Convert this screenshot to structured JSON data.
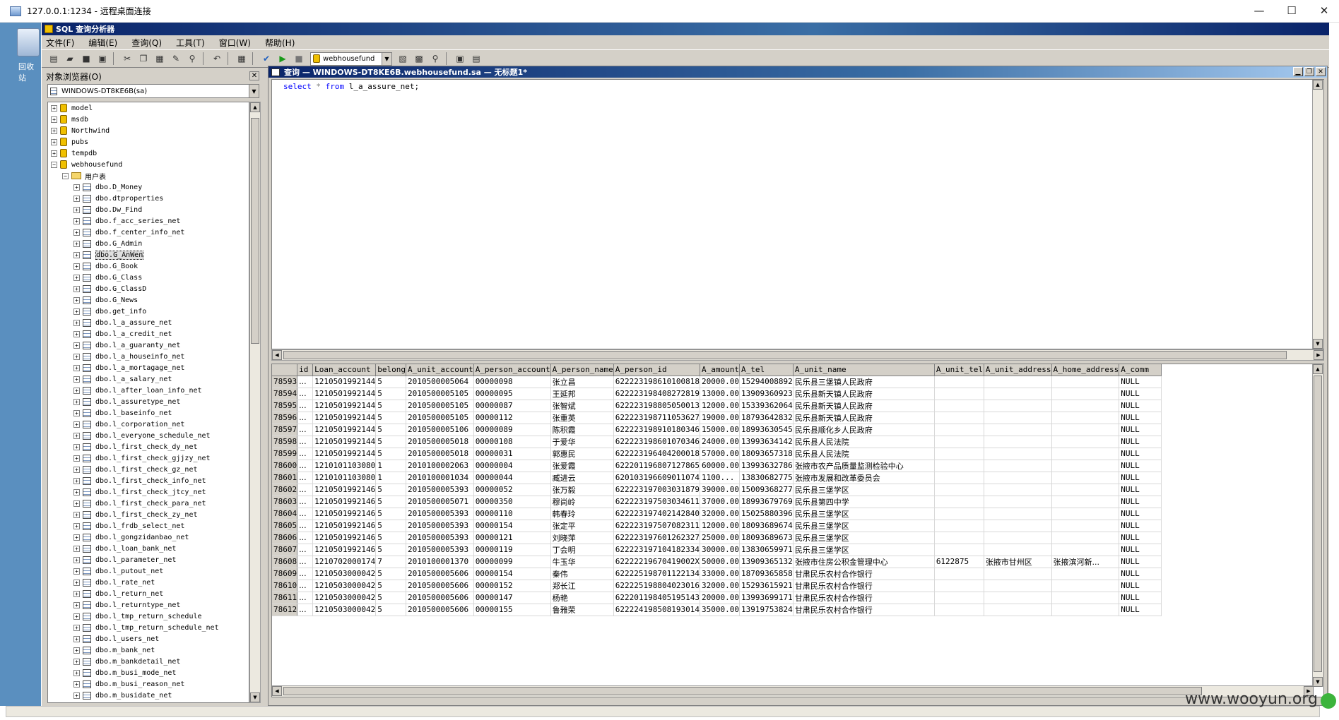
{
  "rdp": {
    "title": "127.0.0.1:1234 - 远程桌面连接",
    "minimize": "—",
    "maximize": "☐",
    "close": "✕",
    "recycle_label": "回收站"
  },
  "app": {
    "title": "SQL 查询分析器"
  },
  "menu": [
    "文件(F)",
    "编辑(E)",
    "查询(Q)",
    "工具(T)",
    "窗口(W)",
    "帮助(H)"
  ],
  "toolbar": {
    "database": "webhousefund"
  },
  "object_browser": {
    "title": "对象浏览器(O)",
    "server": "WINDOWS-DT8KE6B(sa)",
    "databases": [
      "model",
      "msdb",
      "Northwind",
      "pubs",
      "tempdb",
      "webhousefund"
    ],
    "folder": "用户表",
    "tables": [
      "dbo.D_Money",
      "dbo.dtproperties",
      "dbo.Dw_Find",
      "dbo.f_acc_series_net",
      "dbo.f_center_info_net",
      "dbo.G_Admin",
      "dbo.G_AnWen",
      "dbo.G_Book",
      "dbo.G_Class",
      "dbo.G_ClassD",
      "dbo.G_News",
      "dbo.get_info",
      "dbo.l_a_assure_net",
      "dbo.l_a_credit_net",
      "dbo.l_a_guaranty_net",
      "dbo.l_a_houseinfo_net",
      "dbo.l_a_mortagage_net",
      "dbo.l_a_salary_net",
      "dbo.l_after_loan_info_net",
      "dbo.l_assuretype_net",
      "dbo.l_baseinfo_net",
      "dbo.l_corporation_net",
      "dbo.l_everyone_schedule_net",
      "dbo.l_first_check_dy_net",
      "dbo.l_first_check_gjjzy_net",
      "dbo.l_first_check_gz_net",
      "dbo.l_first_check_info_net",
      "dbo.l_first_check_jtcy_net",
      "dbo.l_first_check_para_net",
      "dbo.l_first_check_zy_net",
      "dbo.l_frdb_select_net",
      "dbo.l_gongzidanbao_net",
      "dbo.l_loan_bank_net",
      "dbo.l_parameter_net",
      "dbo.l_putout_net",
      "dbo.l_rate_net",
      "dbo.l_return_net",
      "dbo.l_returntype_net",
      "dbo.l_tmp_return_schedule",
      "dbo.l_tmp_return_schedule_net",
      "dbo.l_users_net",
      "dbo.m_bank_net",
      "dbo.m_bankdetail_net",
      "dbo.m_busi_mode_net",
      "dbo.m_busi_reason_net",
      "dbo.m_busidate_net"
    ],
    "selected_table": "dbo.G_AnWen"
  },
  "query": {
    "title": "查询 — WINDOWS-DT8KE6B.webhousefund.sa — 无标题1*",
    "kw_select": "select",
    "star": "*",
    "kw_from": "from",
    "rest": "l_a_assure_net;"
  },
  "results": {
    "columns": [
      "id",
      "Loan_account",
      "belong",
      "A_unit_account",
      "A_person_account",
      "A_person_name",
      "A_person_id",
      "A_amount",
      "A_tel",
      "A_unit_name",
      "A_unit_tel",
      "A_unit_address",
      "A_home_address",
      "A_comm"
    ],
    "rows": [
      [
        "78593",
        "...",
        "1210501992144",
        "5",
        "2010500005064",
        "00000098",
        "张立昌",
        "622223198610100818",
        "20000.00",
        "15294008892",
        "民乐县三堡镇人民政府",
        "",
        "",
        "",
        "NULL"
      ],
      [
        "78594",
        "...",
        "1210501992144",
        "5",
        "2010500005105",
        "00000095",
        "王延邦",
        "622223198408272819",
        "13000.00",
        "13909360923",
        "民乐县新天镇人民政府",
        "",
        "",
        "",
        "NULL"
      ],
      [
        "78595",
        "...",
        "1210501992144",
        "5",
        "2010500005105",
        "00000087",
        "张智斌",
        "622223198805050013",
        "12000.00",
        "15339362064",
        "民乐县新天镇人民政府",
        "",
        "",
        "",
        "NULL"
      ],
      [
        "78596",
        "...",
        "1210501992144",
        "5",
        "2010500005105",
        "00000112",
        "张重英",
        "622223198711053627",
        "19000.00",
        "18793642832",
        "民乐县新天镇人民政府",
        "",
        "",
        "",
        "NULL"
      ],
      [
        "78597",
        "...",
        "1210501992144",
        "5",
        "2010500005106",
        "00000089",
        "陈积霞",
        "622223198910180346",
        "15000.00",
        "18993630545",
        "民乐县顺化乡人民政府",
        "",
        "",
        "",
        "NULL"
      ],
      [
        "78598",
        "...",
        "1210501992144",
        "5",
        "2010500005018",
        "00000108",
        "于爱华",
        "622223198601070346",
        "24000.00",
        "13993634142",
        "民乐县人民法院",
        "",
        "",
        "",
        "NULL"
      ],
      [
        "78599",
        "...",
        "1210501992144",
        "5",
        "2010500005018",
        "00000031",
        "郭惠民",
        "622223196404200018",
        "57000.00",
        "18093657318",
        "民乐县人民法院",
        "",
        "",
        "",
        "NULL"
      ],
      [
        "78600",
        "...",
        "1210101103080",
        "1",
        "2010100002063",
        "00000004",
        "张爱霞",
        "622201196807127865",
        "60000.00",
        "13993632786",
        "张掖市农产品质量监测检验中心",
        "",
        "",
        "",
        "NULL"
      ],
      [
        "78601",
        "...",
        "1210101103080",
        "1",
        "2010100001034",
        "00000044",
        "臧进云",
        "620103196609011074",
        "1100...",
        "13830682775",
        "张掖市发展和改革委员会",
        "",
        "",
        "",
        "NULL"
      ],
      [
        "78602",
        "...",
        "1210501992146",
        "5",
        "2010500005393",
        "00000052",
        "张万毅",
        "622223197003031879",
        "39000.00",
        "15009368277",
        "民乐县三堡学区",
        "",
        "",
        "",
        "NULL"
      ],
      [
        "78603",
        "...",
        "1210501992146",
        "5",
        "2010500005071",
        "00000350",
        "穆尚岭",
        "622223197503034611",
        "37000.00",
        "18993679769",
        "民乐县第四中学",
        "",
        "",
        "",
        "NULL"
      ],
      [
        "78604",
        "...",
        "1210501992146",
        "5",
        "2010500005393",
        "00000110",
        "韩春玲",
        "622223197402142840",
        "32000.00",
        "15025880396",
        "民乐县三堡学区",
        "",
        "",
        "",
        "NULL"
      ],
      [
        "78605",
        "...",
        "1210501992146",
        "5",
        "2010500005393",
        "00000154",
        "张定平",
        "622223197507082311",
        "12000.00",
        "18093689674",
        "民乐县三堡学区",
        "",
        "",
        "",
        "NULL"
      ],
      [
        "78606",
        "...",
        "1210501992146",
        "5",
        "2010500005393",
        "00000121",
        "刘晓萍",
        "622223197601262327",
        "25000.00",
        "18093689673",
        "民乐县三堡学区",
        "",
        "",
        "",
        "NULL"
      ],
      [
        "78607",
        "...",
        "1210501992146",
        "5",
        "2010500005393",
        "00000119",
        "丁会明",
        "622223197104182334",
        "30000.00",
        "13830659971",
        "民乐县三堡学区",
        "",
        "",
        "",
        "NULL"
      ],
      [
        "78608",
        "...",
        "1210702000174",
        "7",
        "2010100001370",
        "00000099",
        "牛玉华",
        "62222219670419002X",
        "50000.00",
        "13909365132",
        "张掖市住房公积金管理中心",
        "6122875",
        "张掖市甘州区",
        "张掖滨河新...",
        "NULL"
      ],
      [
        "78609",
        "...",
        "1210503000042",
        "5",
        "2010500005606",
        "00000154",
        "秦伟",
        "622225198701122134",
        "33000.00",
        "18709365858",
        "甘肃民乐农村合作银行",
        "",
        "",
        "",
        "NULL"
      ],
      [
        "78610",
        "...",
        "1210503000042",
        "5",
        "2010500005606",
        "00000152",
        "郑长江",
        "622225198804023016",
        "32000.00",
        "15293615921",
        "甘肃民乐农村合作银行",
        "",
        "",
        "",
        "NULL"
      ],
      [
        "78611",
        "...",
        "1210503000042",
        "5",
        "2010500005606",
        "00000147",
        "杨艳",
        "622201198405195143",
        "20000.00",
        "13993699171",
        "甘肃民乐农村合作银行",
        "",
        "",
        "",
        "NULL"
      ],
      [
        "78612",
        "...",
        "1210503000042",
        "5",
        "2010500005606",
        "00000155",
        "鲁雅荣",
        "622224198508193014",
        "35000.00",
        "13919753824",
        "甘肃民乐农村合作银行",
        "",
        "",
        "",
        "NULL"
      ]
    ]
  },
  "watermark": "www.wooyun.org"
}
